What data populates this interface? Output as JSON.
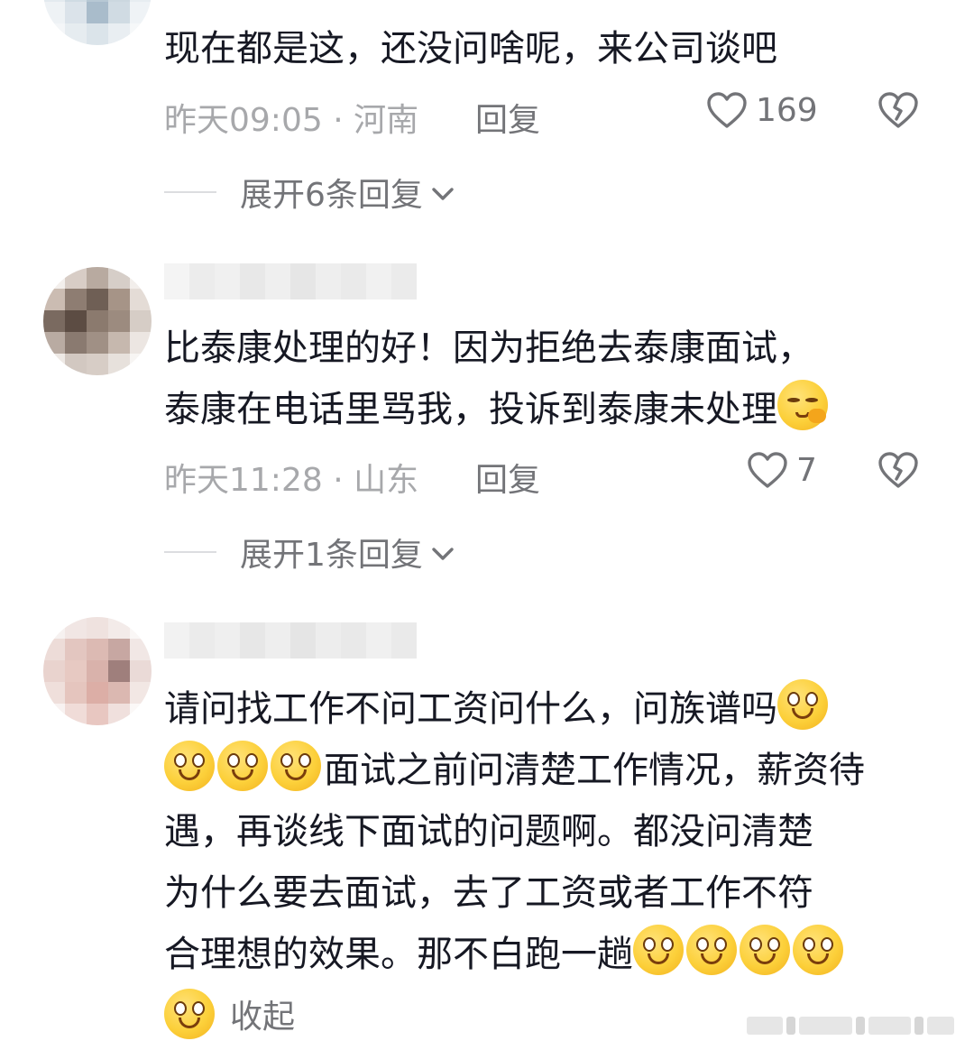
{
  "comments": [
    {
      "text": "现在都是这，还没问啥呢，来公司谈吧",
      "time_location": "昨天09:05 · 河南",
      "reply_label": "回复",
      "like_count": "169",
      "expand_label": "展开6条回复"
    },
    {
      "text_line1": "比泰康处理的好！因为拒绝去泰康面试，",
      "text_line2": "泰康在电话里骂我，投诉到泰康未处理",
      "time_location": "昨天11:28 · 山东",
      "reply_label": "回复",
      "like_count": "7",
      "expand_label": "展开1条回复"
    },
    {
      "line1": "请问找工作不问工资问什么，问族谱吗",
      "line2": "面试之前问清楚工作情况，薪资待",
      "line3": "遇，再谈线下面试的问题啊。都没问清楚",
      "line4": "为什么要去面试，去了工资或者工作不符",
      "line5": "合理想的效果。那不白跑一趟",
      "collapse_label": "收起"
    }
  ],
  "icons": {
    "like": "heart-outline-icon",
    "dislike": "broken-heart-icon",
    "expand": "chevron-down-icon",
    "emoji_smile": "smile-emoji",
    "emoji_shy": "shy-emoji"
  },
  "colors": {
    "text": "#161823",
    "meta": "#a7a8ab",
    "secondary": "#737478"
  }
}
